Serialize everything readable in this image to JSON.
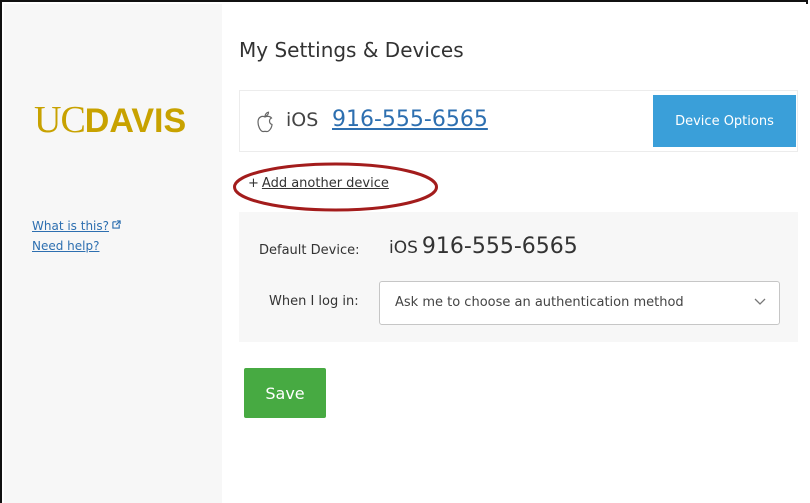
{
  "logo": {
    "part1": "UC",
    "part2": "DAVIS",
    "color": "#c8a200"
  },
  "sidebar": {
    "links": [
      {
        "label": "What is this?"
      },
      {
        "label": "Need help?"
      }
    ]
  },
  "main": {
    "title": "My Settings & Devices",
    "device": {
      "type": "iOS",
      "number": "916-555-6565",
      "options_label": "Device Options"
    },
    "add_device": {
      "plus": "+",
      "label": "Add another device"
    },
    "settings": {
      "default_label": "Default Device:",
      "default_type": "iOS",
      "default_number": "916-555-6565",
      "login_label": "When I log in:",
      "login_value": "Ask me to choose an authentication method"
    },
    "save_label": "Save"
  },
  "colors": {
    "link": "#2d6fb0",
    "primary_button": "#3a9fd9",
    "save_button": "#47aa42",
    "highlight": "#a31c1c"
  },
  "icons": {
    "device": "apple-icon",
    "external_link": "external-link-icon",
    "select": "chevron-down-icon"
  }
}
